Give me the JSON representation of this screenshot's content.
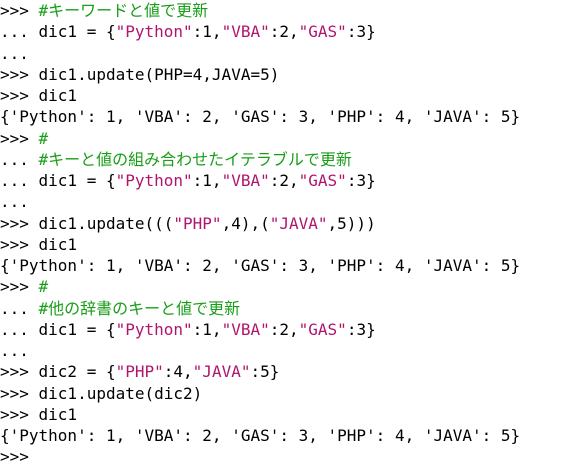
{
  "console": {
    "colors": {
      "background": "#ffffff",
      "text": "#000000",
      "comment": "#1a9e1a",
      "string": "#b0156e"
    },
    "lines": [
      [
        {
          "t": ">>> ",
          "c": "prompt"
        },
        {
          "t": "#キーワードと値で更新",
          "c": "comment"
        }
      ],
      [
        {
          "t": "... dic1 = {",
          "c": "prompt"
        },
        {
          "t": "\"Python\"",
          "c": "string"
        },
        {
          "t": ":1,",
          "c": "prompt"
        },
        {
          "t": "\"VBA\"",
          "c": "string"
        },
        {
          "t": ":2,",
          "c": "prompt"
        },
        {
          "t": "\"GAS\"",
          "c": "string"
        },
        {
          "t": ":3}",
          "c": "prompt"
        }
      ],
      [
        {
          "t": "...",
          "c": "prompt"
        }
      ],
      [
        {
          "t": ">>> dic1.update(PHP=4,JAVA=5)",
          "c": "prompt"
        }
      ],
      [
        {
          "t": ">>> dic1",
          "c": "prompt"
        }
      ],
      [
        {
          "t": "{'Python': 1, 'VBA': 2, 'GAS': 3, 'PHP': 4, 'JAVA': 5}",
          "c": "prompt"
        }
      ],
      [
        {
          "t": ">>> ",
          "c": "prompt"
        },
        {
          "t": "#",
          "c": "comment"
        }
      ],
      [
        {
          "t": "... ",
          "c": "prompt"
        },
        {
          "t": "#キーと値の組み合わせたイテラブルで更新",
          "c": "comment"
        }
      ],
      [
        {
          "t": "... dic1 = {",
          "c": "prompt"
        },
        {
          "t": "\"Python\"",
          "c": "string"
        },
        {
          "t": ":1,",
          "c": "prompt"
        },
        {
          "t": "\"VBA\"",
          "c": "string"
        },
        {
          "t": ":2,",
          "c": "prompt"
        },
        {
          "t": "\"GAS\"",
          "c": "string"
        },
        {
          "t": ":3}",
          "c": "prompt"
        }
      ],
      [
        {
          "t": "...",
          "c": "prompt"
        }
      ],
      [
        {
          "t": ">>> dic1.update(((",
          "c": "prompt"
        },
        {
          "t": "\"PHP\"",
          "c": "string"
        },
        {
          "t": ",4),(",
          "c": "prompt"
        },
        {
          "t": "\"JAVA\"",
          "c": "string"
        },
        {
          "t": ",5)))",
          "c": "prompt"
        }
      ],
      [
        {
          "t": ">>> dic1",
          "c": "prompt"
        }
      ],
      [
        {
          "t": "{'Python': 1, 'VBA': 2, 'GAS': 3, 'PHP': 4, 'JAVA': 5}",
          "c": "prompt"
        }
      ],
      [
        {
          "t": ">>> ",
          "c": "prompt"
        },
        {
          "t": "#",
          "c": "comment"
        }
      ],
      [
        {
          "t": "... ",
          "c": "prompt"
        },
        {
          "t": "#他の辞書のキーと値で更新",
          "c": "comment"
        }
      ],
      [
        {
          "t": "... dic1 = {",
          "c": "prompt"
        },
        {
          "t": "\"Python\"",
          "c": "string"
        },
        {
          "t": ":1,",
          "c": "prompt"
        },
        {
          "t": "\"VBA\"",
          "c": "string"
        },
        {
          "t": ":2,",
          "c": "prompt"
        },
        {
          "t": "\"GAS\"",
          "c": "string"
        },
        {
          "t": ":3}",
          "c": "prompt"
        }
      ],
      [
        {
          "t": "...",
          "c": "prompt"
        }
      ],
      [
        {
          "t": ">>> dic2 = {",
          "c": "prompt"
        },
        {
          "t": "\"PHP\"",
          "c": "string"
        },
        {
          "t": ":4,",
          "c": "prompt"
        },
        {
          "t": "\"JAVA\"",
          "c": "string"
        },
        {
          "t": ":5}",
          "c": "prompt"
        }
      ],
      [
        {
          "t": ">>> dic1.update(dic2)",
          "c": "prompt"
        }
      ],
      [
        {
          "t": ">>> dic1",
          "c": "prompt"
        }
      ],
      [
        {
          "t": "{'Python': 1, 'VBA': 2, 'GAS': 3, 'PHP': 4, 'JAVA': 5}",
          "c": "prompt"
        }
      ],
      [
        {
          "t": ">>>",
          "c": "prompt"
        }
      ]
    ]
  }
}
